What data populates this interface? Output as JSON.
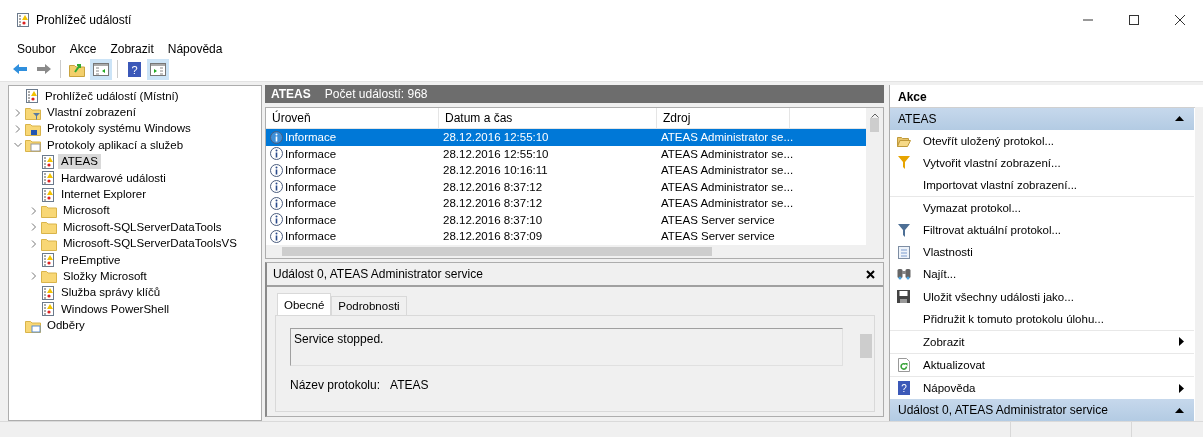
{
  "window": {
    "title": "Prohlížeč událostí"
  },
  "menu": [
    "Soubor",
    "Akce",
    "Zobrazit",
    "Nápověda"
  ],
  "toolbar": [
    {
      "kind": "back",
      "on": false
    },
    {
      "kind": "forward",
      "on": false
    },
    {
      "kind": "up",
      "on": false
    },
    {
      "kind": "tree-toggle",
      "on": true
    },
    {
      "kind": "help",
      "on": false,
      "glyph": "?"
    },
    {
      "kind": "pane-toggle",
      "on": true
    }
  ],
  "tree": [
    {
      "label": "Prohlížeč událostí (Místní)",
      "kind": "root",
      "selected": false,
      "children": [
        {
          "label": "Vlastní zobrazení",
          "kind": "filter-folder",
          "selected": false,
          "expanded": false
        },
        {
          "label": "Protokoly systému Windows",
          "kind": "system-folder",
          "selected": false,
          "expanded": false
        },
        {
          "label": "Protokoly aplikací a služeb",
          "kind": "folder-open",
          "selected": false,
          "expanded": true,
          "children": [
            {
              "label": "ATEAS",
              "kind": "log",
              "selected": true
            },
            {
              "label": "Hardwarové události",
              "kind": "log",
              "selected": false
            },
            {
              "label": "Internet Explorer",
              "kind": "log",
              "selected": false
            },
            {
              "label": "Microsoft",
              "kind": "folder",
              "selected": false,
              "expanded": false
            },
            {
              "label": "Microsoft-SQLServerDataTools",
              "kind": "folder",
              "selected": false,
              "expanded": false
            },
            {
              "label": "Microsoft-SQLServerDataToolsVS",
              "kind": "folder",
              "selected": false,
              "expanded": false
            },
            {
              "label": "PreEmptive",
              "kind": "log",
              "selected": false
            },
            {
              "label": "Složky Microsoft",
              "kind": "folder",
              "selected": false,
              "expanded": false
            },
            {
              "label": "Služba správy klíčů",
              "kind": "log",
              "selected": false
            },
            {
              "label": "Windows PowerShell",
              "kind": "log",
              "selected": false
            }
          ]
        },
        {
          "label": "Odběry",
          "kind": "subscriptions",
          "selected": false
        }
      ]
    }
  ],
  "log_header": {
    "name": "ATEAS",
    "count": "Počet událostí: 968"
  },
  "table": {
    "columns": [
      "Úroveň",
      "Datum a čas",
      "Zdroj"
    ],
    "rows": [
      {
        "level": "Informace",
        "date": "28.12.2016 12:55:10",
        "source": "ATEAS Administrator se...",
        "selected": true
      },
      {
        "level": "Informace",
        "date": "28.12.2016 12:55:10",
        "source": "ATEAS Administrator se...",
        "selected": false
      },
      {
        "level": "Informace",
        "date": "28.12.2016 10:16:11",
        "source": "ATEAS Administrator se...",
        "selected": false
      },
      {
        "level": "Informace",
        "date": "28.12.2016 8:37:12",
        "source": "ATEAS Administrator se...",
        "selected": false
      },
      {
        "level": "Informace",
        "date": "28.12.2016 8:37:12",
        "source": "ATEAS Administrator se...",
        "selected": false
      },
      {
        "level": "Informace",
        "date": "28.12.2016 8:37:10",
        "source": "ATEAS Server service",
        "selected": false
      },
      {
        "level": "Informace",
        "date": "28.12.2016 8:37:09",
        "source": "ATEAS Server service",
        "selected": false
      }
    ]
  },
  "detail": {
    "title": "Událost 0, ATEAS Administrator service",
    "tabs": [
      {
        "label": "Obecné",
        "selected": true
      },
      {
        "label": "Podrobnosti",
        "selected": false
      }
    ],
    "description": "Service stopped.",
    "log_name_label": "Název protokolu:",
    "log_name": "ATEAS"
  },
  "actions": {
    "title": "Akce",
    "sections": [
      {
        "title": "ATEAS",
        "expanded": true,
        "items": [
          {
            "label": "Otevřít uložený protokol...",
            "kind": "open-folder",
            "submenu": false,
            "separator_before": false
          },
          {
            "label": "Vytvořit vlastní zobrazení...",
            "kind": "funnel-gold",
            "submenu": false,
            "separator_before": false
          },
          {
            "label": "Importovat vlastní zobrazení...",
            "kind": "plain",
            "submenu": false,
            "separator_before": false
          },
          {
            "label": "Vymazat protokol...",
            "kind": "plain",
            "submenu": false,
            "separator_before": true
          },
          {
            "label": "Filtrovat aktuální protokol...",
            "kind": "funnel",
            "submenu": false,
            "separator_before": false
          },
          {
            "label": "Vlastnosti",
            "kind": "properties",
            "submenu": false,
            "separator_before": false
          },
          {
            "label": "Najít...",
            "kind": "binoculars",
            "submenu": false,
            "separator_before": false
          },
          {
            "label": "Uložit všechny události jako...",
            "kind": "save",
            "submenu": false,
            "separator_before": false
          },
          {
            "label": "Přidružit k tomuto protokolu úlohu...",
            "kind": "plain",
            "submenu": false,
            "separator_before": false
          },
          {
            "label": "Zobrazit",
            "kind": "plain",
            "submenu": true,
            "separator_before": true
          },
          {
            "label": "Aktualizovat",
            "kind": "refresh",
            "submenu": false,
            "separator_before": true
          },
          {
            "label": "Nápověda",
            "kind": "help",
            "glyph": "?",
            "submenu": true,
            "separator_before": true
          }
        ]
      },
      {
        "title": "Událost 0, ATEAS Administrator service",
        "expanded": true
      }
    ]
  }
}
